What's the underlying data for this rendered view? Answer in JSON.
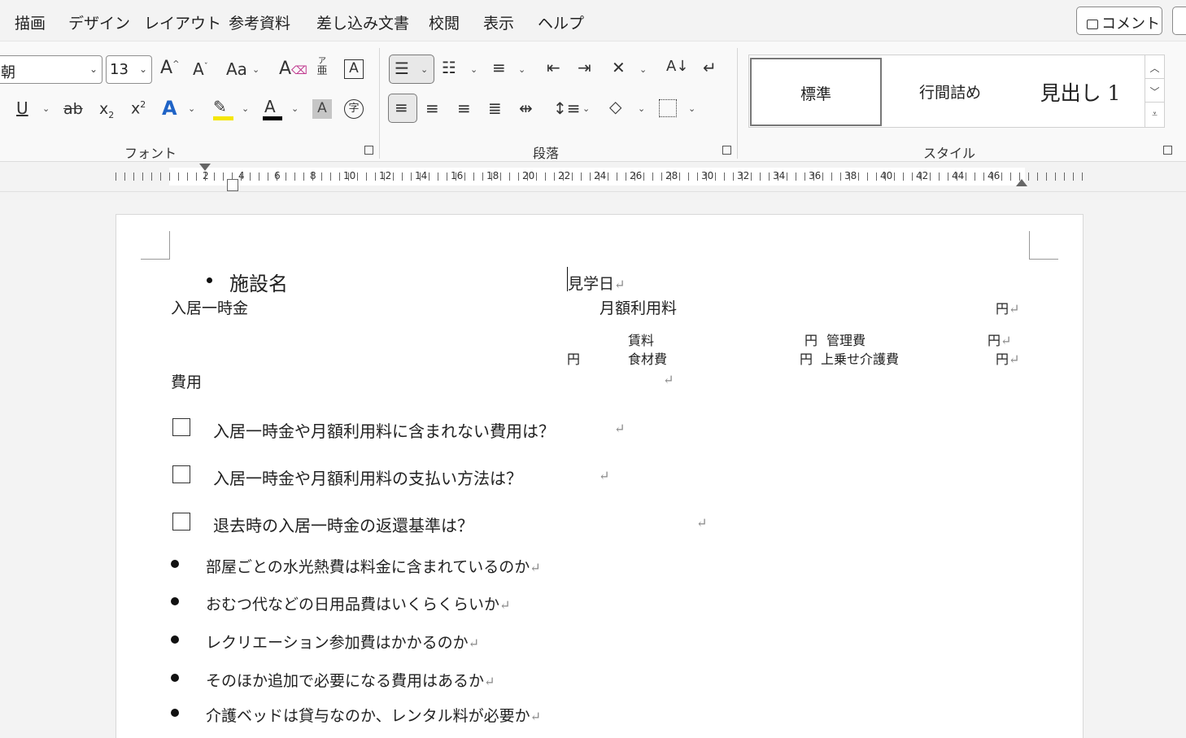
{
  "menu": {
    "tabs": [
      "描画",
      "デザイン",
      "レイアウト",
      "参考資料",
      "差し込み文書",
      "校閲",
      "表示",
      "ヘルプ"
    ],
    "comment_label": "コメント"
  },
  "ribbon": {
    "font": {
      "font_name": "朝",
      "font_size": "13",
      "grow_label": "A",
      "shrink_label": "A",
      "case_label": "Aa",
      "furigana_top": "ア",
      "furigana_bottom": "亜",
      "border_char": "A",
      "underline": "U",
      "strike": "ab",
      "subscript": "x",
      "superscript": "x",
      "text_effect": "A",
      "font_color": "A",
      "shading_char": "A",
      "enclose_char": "字",
      "label": "フォント",
      "highlight_color": "#f5e600",
      "font_color_swatch": "#000000"
    },
    "paragraph": {
      "label": "段落"
    },
    "styles": {
      "label": "スタイル",
      "items": [
        "標準",
        "行間詰め",
        "見出し 1"
      ]
    }
  },
  "ruler": {
    "numbers": [
      "2",
      "4",
      "6",
      "8",
      "10",
      "12",
      "14",
      "16",
      "18",
      "20",
      "22",
      "24",
      "26",
      "28",
      "30",
      "32",
      "34",
      "36",
      "38",
      "40",
      "42",
      "44",
      "46"
    ]
  },
  "document": {
    "facility_name": "施設名",
    "visit_date": "見学日",
    "entry_fee": "入居一時金",
    "monthly_fee": "月額利用料",
    "yen": "円",
    "rent": "賃料",
    "management_fee": "管理費",
    "food_cost": "食材費",
    "extra_care_fee": "上乗せ介護費",
    "costs_heading": "費用",
    "checklist": [
      "入居一時金や月額利用料に含まれない費用は？",
      "入居一時金や月額利用料の支払い方法は？",
      "退去時の入居一時金の返還基準は？"
    ],
    "bullets": [
      "部屋ごとの水光熱費は料金に含まれているのか",
      "おむつ代などの日用品費はいくらくらいか",
      "レクリエーション参加費はかかるのか",
      "そのほか追加で必要になる費用はあるか",
      "介護ベッドは貸与なのか、レンタル料が必要か"
    ],
    "paragraph_mark": "↵"
  }
}
